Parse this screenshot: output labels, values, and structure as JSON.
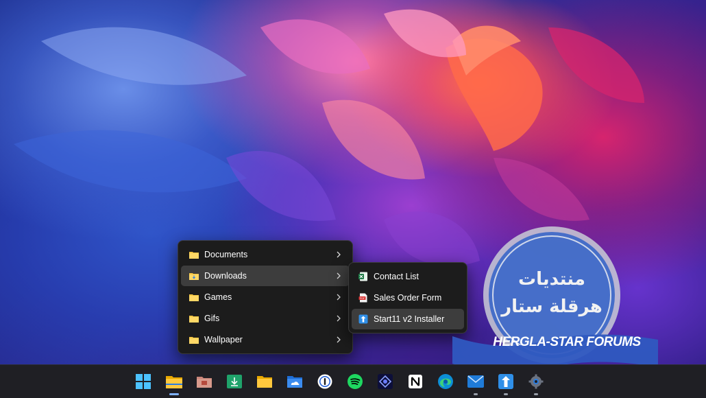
{
  "main_menu": {
    "items": [
      {
        "label": "Documents",
        "icon": "folder-icon",
        "has_submenu": true
      },
      {
        "label": "Downloads",
        "icon": "download-folder-icon",
        "has_submenu": true,
        "active": true
      },
      {
        "label": "Games",
        "icon": "folder-icon",
        "has_submenu": true
      },
      {
        "label": "Gifs",
        "icon": "folder-icon",
        "has_submenu": true
      },
      {
        "label": "Wallpaper",
        "icon": "folder-icon",
        "has_submenu": true
      }
    ]
  },
  "submenu": {
    "items": [
      {
        "label": "Contact List",
        "icon": "excel-icon"
      },
      {
        "label": "Sales Order Form",
        "icon": "pdf-icon"
      },
      {
        "label": "Start11 v2 Installer",
        "icon": "installer-icon",
        "active": true
      }
    ]
  },
  "watermark": {
    "line1": "منتديات",
    "line2": "هرقلة ستار",
    "banner": "HERGLA-STAR FORUMS"
  },
  "taskbar": {
    "icons": [
      "windows-start-icon",
      "file-explorer-icon",
      "toolbox-icon",
      "downloads-app-icon",
      "folder-app-icon",
      "onedrive-folder-icon",
      "password-manager-icon",
      "spotify-icon",
      "app-launcher-icon",
      "notion-icon",
      "edge-icon",
      "mail-icon",
      "start11-icon",
      "settings-icon"
    ],
    "running_indicators": [
      1,
      11,
      12,
      13
    ],
    "active_indicator": 1
  },
  "colors": {
    "menu_bg": "#1c1c1c",
    "menu_active": "#3d3d3d",
    "folder_yellow": "#f4c542",
    "accent": "#4aa3ff"
  }
}
